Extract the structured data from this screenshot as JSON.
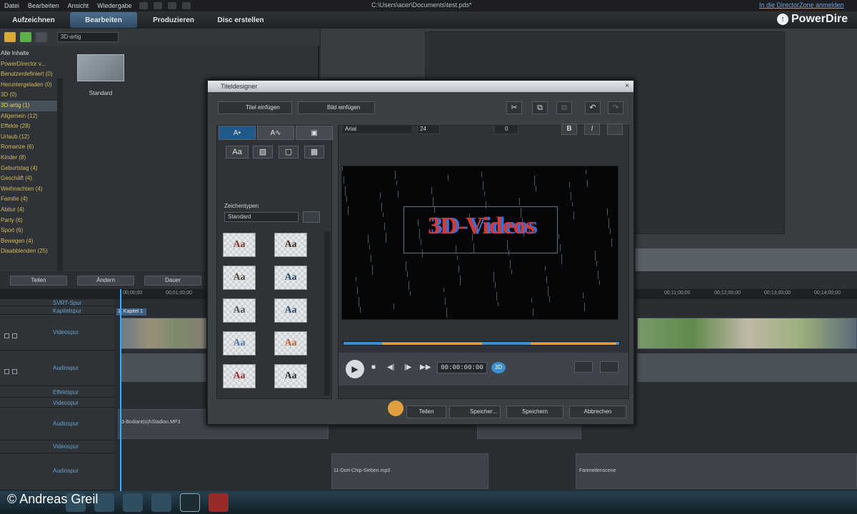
{
  "menubar": {
    "items": [
      "Datei",
      "Bearbeiten",
      "Ansicht",
      "Wiedergabe"
    ],
    "file_path": "C:\\Users\\acer\\Documents\\test.pds*",
    "director_zone_link": "In die DirectorZone anmelden"
  },
  "mode_tabs": [
    {
      "label": "Aufzeichnen",
      "active": false
    },
    {
      "label": "Bearbeiten",
      "active": true
    },
    {
      "label": "Produzieren",
      "active": false
    },
    {
      "label": "Disc erstellen",
      "active": false
    }
  ],
  "brand": {
    "name": "PowerDire",
    "logo_glyph": "↑"
  },
  "library": {
    "filter_value": "3D-artig",
    "categories": [
      {
        "label": "Alle Inhalte",
        "type": "head"
      },
      {
        "label": "PowerDirector v...",
        "type": "item"
      },
      {
        "label": "Benutzerdefiniert (0)",
        "type": "item"
      },
      {
        "label": "Heruntergeladen (0)",
        "type": "item"
      },
      {
        "label": "3D (0)",
        "type": "item"
      },
      {
        "label": "3D-artig (1)",
        "type": "selected"
      },
      {
        "label": "Allgemein (12)",
        "type": "item"
      },
      {
        "label": "Effekte (28)",
        "type": "item"
      },
      {
        "label": "Urlaub (12)",
        "type": "item"
      },
      {
        "label": "Romanze (6)",
        "type": "item"
      },
      {
        "label": "Kinder (8)",
        "type": "item"
      },
      {
        "label": "Geburtstag (4)",
        "type": "item"
      },
      {
        "label": "Geschäft (4)",
        "type": "item"
      },
      {
        "label": "Weihnachten (4)",
        "type": "item"
      },
      {
        "label": "Familie (4)",
        "type": "item"
      },
      {
        "label": "Abitur (4)",
        "type": "item"
      },
      {
        "label": "Party (6)",
        "type": "item"
      },
      {
        "label": "Sport (6)",
        "type": "item"
      },
      {
        "label": "Bewegen (4)",
        "type": "item"
      },
      {
        "label": "Diaabblenden (25)",
        "type": "item"
      }
    ],
    "thumbnail_label": "Standard"
  },
  "timeline": {
    "toolbar_buttons": [
      "Teilen",
      "Ändern",
      "Dauer"
    ],
    "ruler_ticks": [
      "00;00;00",
      "00;01;00;00",
      "00;11;00;00",
      "00;12;00;00",
      "00;13;00;00",
      "00;14;00;00"
    ],
    "chapter_label": "1. Kapitel 1",
    "tracks": [
      {
        "label": "SVRT-Spur",
        "kind": "svrt"
      },
      {
        "label": "Kapitelspur",
        "kind": "chapter"
      },
      {
        "label": "Videospur",
        "kind": "video"
      },
      {
        "label": "Audiospur",
        "kind": "audio"
      },
      {
        "label": "Effektspur",
        "kind": "effect"
      },
      {
        "label": "Videospur",
        "kind": "video2"
      },
      {
        "label": "Audiospur",
        "kind": "audio2"
      },
      {
        "label": "Videospur",
        "kind": "video3"
      },
      {
        "label": "Audiospur",
        "kind": "audio3"
      }
    ],
    "audio_clip_labels": [
      "3-Bodiant(o)hStadion.MP3",
      "11-Dort-Chip-Sieben.mp3",
      "Fanmeilenscene"
    ]
  },
  "dialog": {
    "title": "Titeldesigner",
    "close_glyph": "×",
    "insert_title": "Titel einfügen",
    "insert_image": "Bild einfügen",
    "left_tabs": [
      "A•",
      "A∿",
      "▣"
    ],
    "style_buttons": [
      "Aa",
      "▧",
      "▢",
      "▦"
    ],
    "char_type_label": "Zeichentypen",
    "char_type_value": "Standard",
    "presets": [
      {
        "text": "Aa",
        "color": "#7a3d2a"
      },
      {
        "text": "Aa",
        "color": "#3a2d25"
      },
      {
        "text": "Aa",
        "color": "#4c4a30"
      },
      {
        "text": "Aa",
        "color": "#2c4a68"
      },
      {
        "text": "Aa",
        "color": "#4a5055"
      },
      {
        "text": "Aa",
        "color": "#2c4a68"
      },
      {
        "text": "Aa",
        "color": "#4f7aa0"
      },
      {
        "text": "Aa",
        "color": "#c06030"
      },
      {
        "text": "Aa",
        "color": "#9a3030"
      },
      {
        "text": "Aa",
        "color": "#2a3038"
      }
    ],
    "font_value": "Arial",
    "size_value": "24",
    "spacing_value": "0",
    "bold_label": "B",
    "italic_label": "I",
    "title_text": "3D-Videos",
    "timecode": "00:00:00:00",
    "btn_3d": "3D",
    "share_label": "Teilen",
    "save_as_label": "Speicher...",
    "save_label": "Speichern",
    "cancel_label": "Abbrechen"
  },
  "credit": "© Andreas Greil"
}
